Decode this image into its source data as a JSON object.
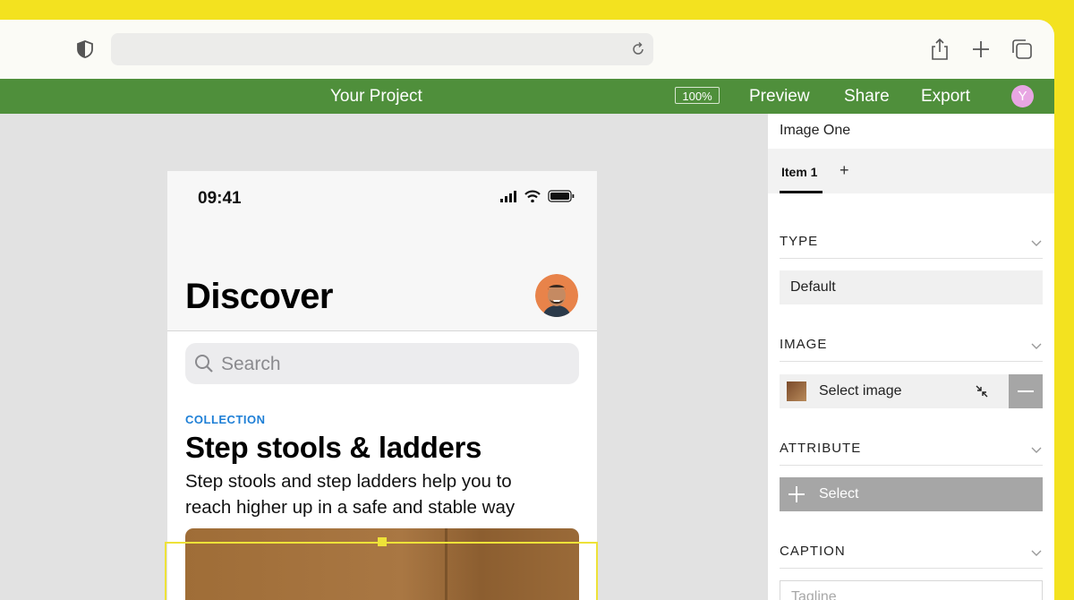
{
  "app": {
    "title": "Your Project",
    "zoom": "100%",
    "menu": [
      "Preview",
      "Share",
      "Export"
    ],
    "user_initial": "Y"
  },
  "phone": {
    "time": "09:41",
    "page_title": "Discover",
    "search_placeholder": "Search",
    "eyebrow": "COLLECTION",
    "headline": "Step stools & ladders",
    "description": "Step stools and step ladders help you to reach higher up in a safe and stable way"
  },
  "panel": {
    "title": "Image One",
    "tab": "Item 1",
    "tab_add": "+",
    "sections": {
      "type": {
        "label": "TYPE",
        "value": "Default"
      },
      "image": {
        "label": "IMAGE",
        "value": "Select image"
      },
      "attribute": {
        "label": "ATTRIBUTE",
        "button": "Select"
      },
      "caption": {
        "label": "CAPTION",
        "placeholder": "Tagline"
      }
    }
  },
  "colors": {
    "background": "#f3e21f",
    "appbar": "#4f8f3b",
    "accent_link": "#1e7fd6",
    "selection": "#eee238"
  }
}
